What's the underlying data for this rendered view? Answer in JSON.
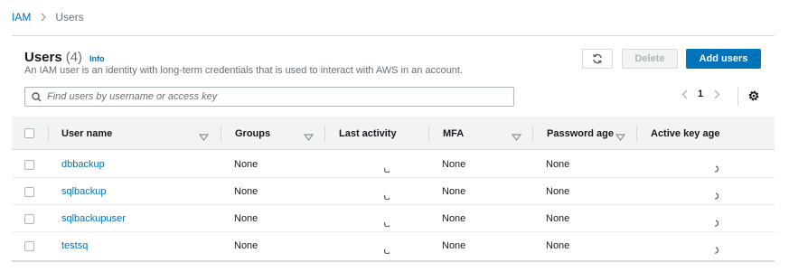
{
  "breadcrumb": {
    "root": "IAM",
    "current": "Users"
  },
  "header": {
    "title": "Users",
    "count": "(4)",
    "info": "Info",
    "description": "An IAM user is an identity with long-term credentials that is used to interact with AWS in an account."
  },
  "actions": {
    "delete_label": "Delete",
    "add_label": "Add users"
  },
  "search": {
    "placeholder": "Find users by username or access key",
    "value": ""
  },
  "pagination": {
    "page": "1"
  },
  "table": {
    "columns": [
      "User name",
      "Groups",
      "Last activity",
      "MFA",
      "Password age",
      "Active key age"
    ],
    "rows": [
      {
        "user": "dbbackup",
        "groups": "None",
        "mfa": "None",
        "password_age": "None"
      },
      {
        "user": "sqlbackup",
        "groups": "None",
        "mfa": "None",
        "password_age": "None"
      },
      {
        "user": "sqlbackupuser",
        "groups": "None",
        "mfa": "None",
        "password_age": "None"
      },
      {
        "user": "testsq",
        "groups": "None",
        "mfa": "None",
        "password_age": "None"
      }
    ]
  },
  "colors": {
    "accent": "#0073bb",
    "header_bg": "#f2f3f3",
    "border": "#d5dbdb"
  },
  "icons": {
    "refresh": "refresh-icon",
    "search": "search-icon",
    "settings": "gear-icon",
    "sort": "caret-down-icon",
    "loading": "spinner-icon",
    "pager_prev": "chevron-left-icon",
    "pager_next": "chevron-right-icon"
  }
}
